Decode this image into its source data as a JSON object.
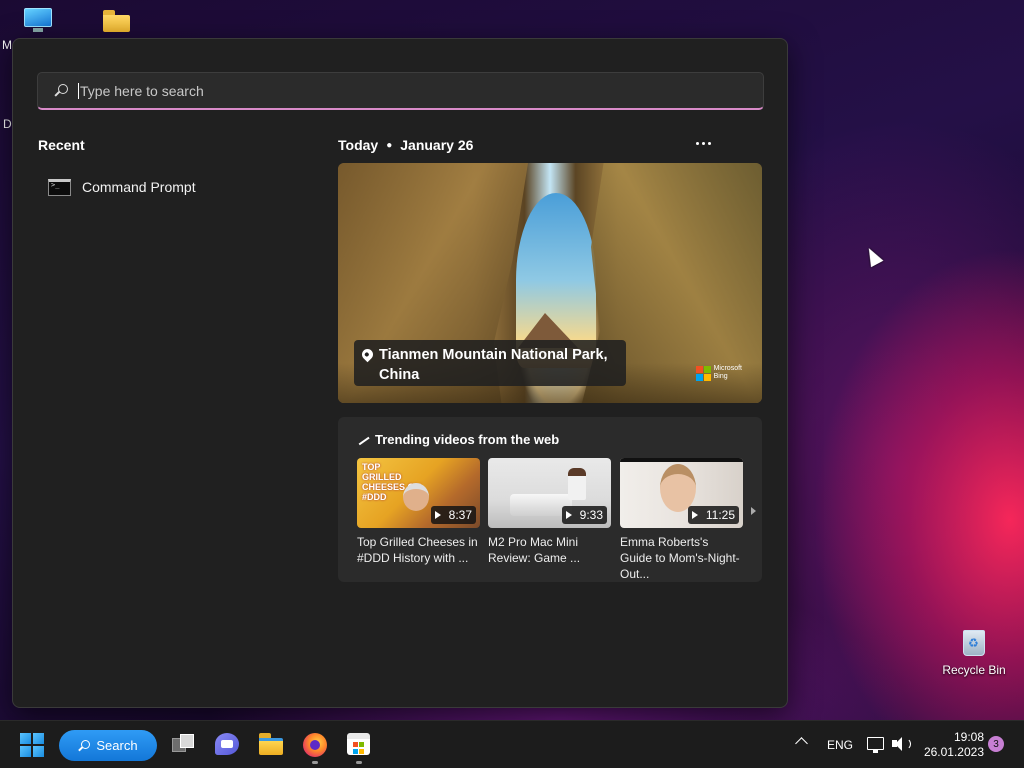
{
  "desktop": {
    "left_edge_labels": [
      "M",
      "D"
    ],
    "recycle_bin_label": "Recycle Bin"
  },
  "search_panel": {
    "search_placeholder": "Type here to search",
    "recent_heading": "Recent",
    "recent_items": [
      {
        "label": "Command Prompt",
        "icon": "command-prompt-icon"
      }
    ],
    "today_label": "Today",
    "today_date": "January 26",
    "hero": {
      "location": "Tianmen Mountain National Park, China",
      "brand_lines": [
        "Microsoft",
        "Bing"
      ]
    },
    "trending": {
      "title": "Trending videos from the web",
      "videos": [
        {
          "title": "Top Grilled Cheeses in #DDD History with ...",
          "duration": "8:37",
          "thumb_text": "TOP GRILLED CHEESES ON #DDD"
        },
        {
          "title": "M2 Pro Mac Mini Review: Game ...",
          "duration": "9:33"
        },
        {
          "title": "Emma Roberts's Guide to Mom's-Night-Out...",
          "duration": "11:25"
        }
      ]
    }
  },
  "taskbar": {
    "search_label": "Search",
    "language": "ENG",
    "time": "19:08",
    "date": "26.01.2023",
    "notification_count": "3",
    "accent": "#1a86e0"
  }
}
